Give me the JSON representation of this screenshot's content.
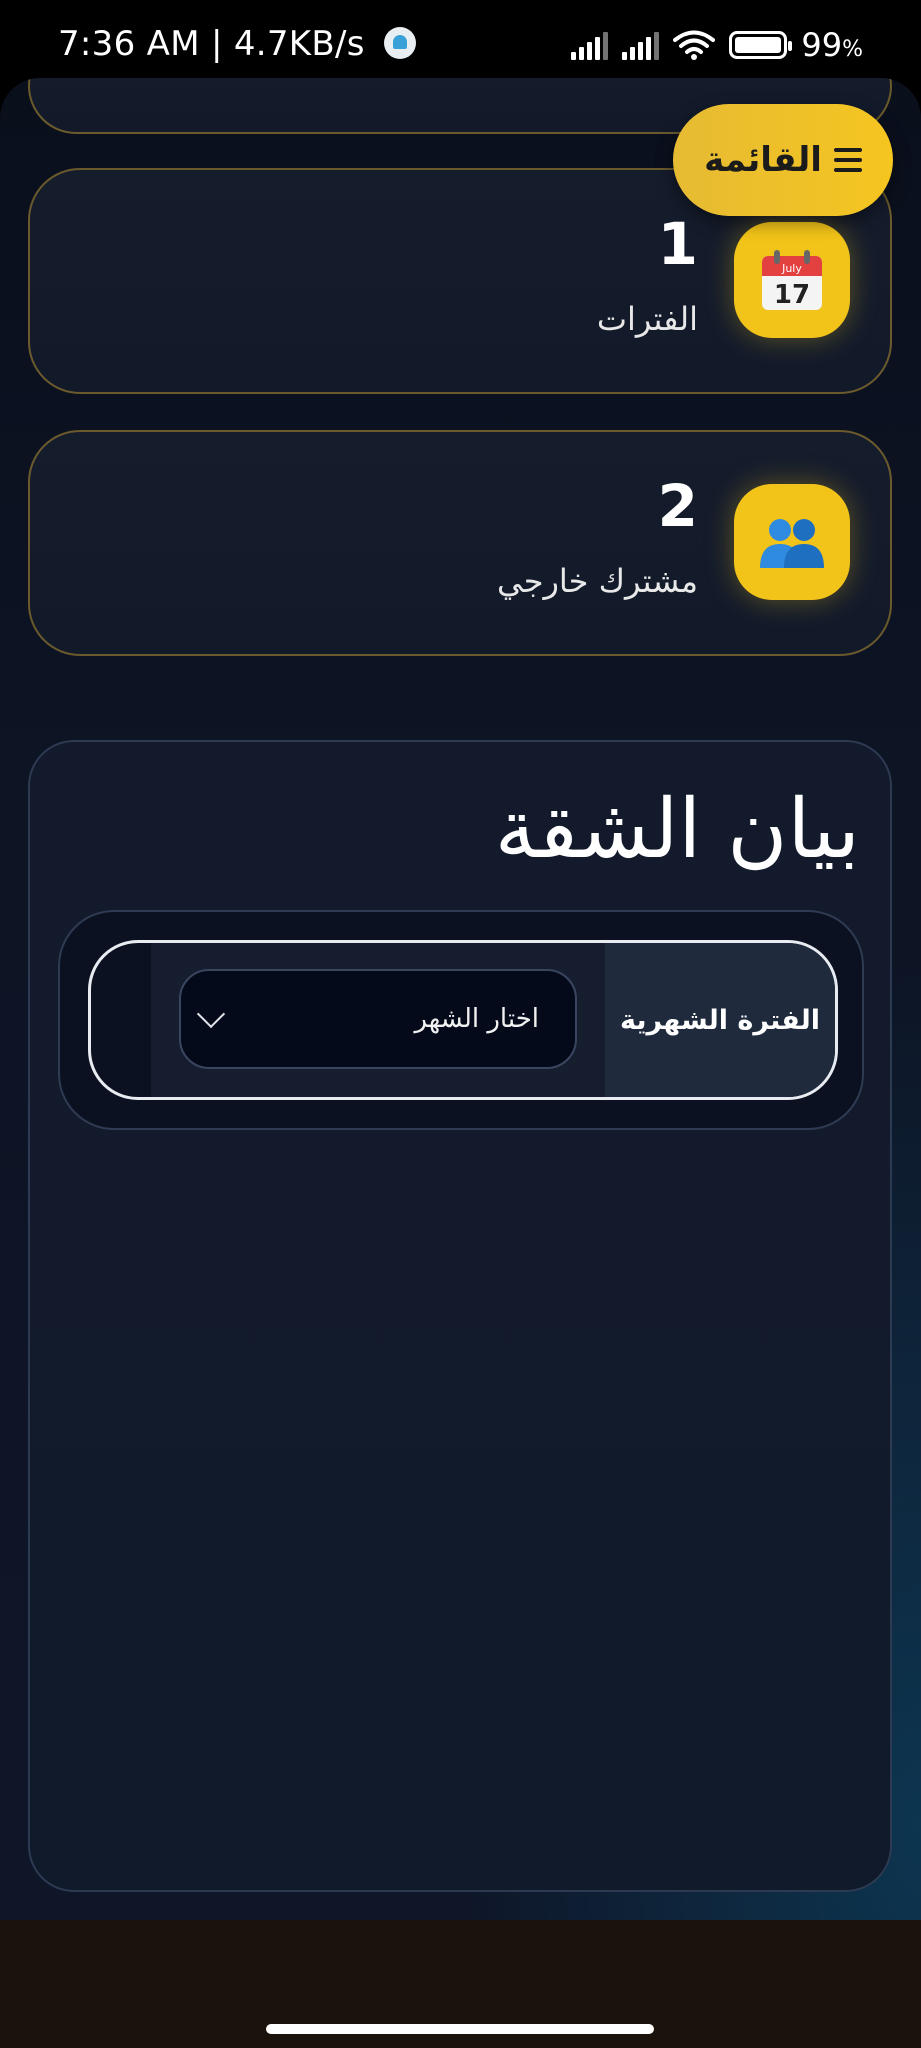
{
  "status_bar": {
    "left_text": "7:36 AM | 4.7KB/s",
    "battery_percent": "99",
    "battery_unit": "%"
  },
  "menu_button": {
    "label": "القائمة",
    "icon": "hamburger-icon"
  },
  "stats": [
    {
      "number": "1",
      "label": "الفترات",
      "icon": "calendar-icon",
      "icon_glyph": "📅"
    },
    {
      "number": "2",
      "label": "مشترك خارجي",
      "icon": "people-icon",
      "icon_glyph": "👥"
    }
  ],
  "panel": {
    "title": "بيان الشقة",
    "filter": {
      "label": "الفترة الشهرية",
      "select_placeholder": "اختار الشهر"
    }
  },
  "colors": {
    "accent": "#f2c318",
    "background": "#0d1424",
    "card_border": "#6b5a2c"
  }
}
